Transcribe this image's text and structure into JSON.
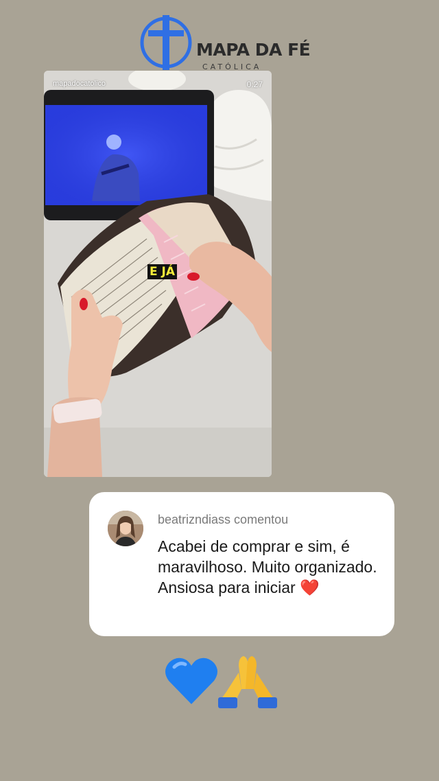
{
  "brand": {
    "title": "MAPA DA FÉ",
    "subtitle": "CATÓLICA",
    "accent_color": "#2f6fe4",
    "icon": "cross-circle-logo"
  },
  "video": {
    "username": "mapadocatolico",
    "timestamp": "0:27",
    "caption": "E JÁ"
  },
  "comment": {
    "header": "beatrizndiass comentou",
    "text": "Acabei de comprar e sim, é maravilhoso. Muito organizado. Ansiosa para iniciar",
    "emoji": "❤️"
  },
  "reactions": {
    "items": [
      "blue-heart-emoji",
      "praying-hands-emoji"
    ]
  }
}
